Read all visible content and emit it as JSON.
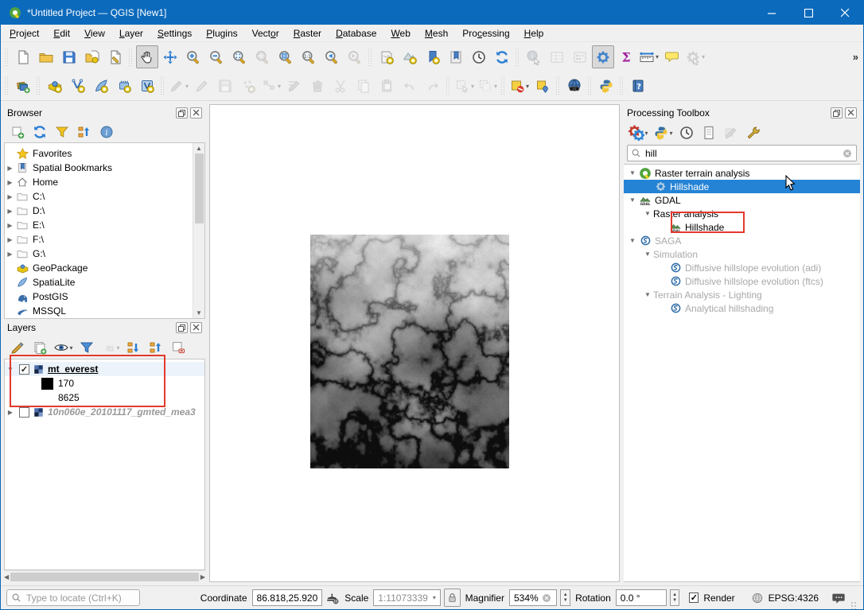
{
  "window": {
    "title": "*Untitled Project — QGIS [New1]"
  },
  "menu": {
    "items": [
      {
        "label": "Project",
        "u": 0
      },
      {
        "label": "Edit",
        "u": 0
      },
      {
        "label": "View",
        "u": 0
      },
      {
        "label": "Layer",
        "u": 0
      },
      {
        "label": "Settings",
        "u": 0
      },
      {
        "label": "Plugins",
        "u": 0
      },
      {
        "label": "Vector",
        "u": 4
      },
      {
        "label": "Raster",
        "u": 0
      },
      {
        "label": "Database",
        "u": 0
      },
      {
        "label": "Web",
        "u": 0
      },
      {
        "label": "Mesh",
        "u": 0
      },
      {
        "label": "Processing",
        "u": 3
      },
      {
        "label": "Help",
        "u": 0
      }
    ]
  },
  "toolbar_main": {
    "overflow": "»",
    "groups": [
      [
        {
          "icon": "new-project"
        },
        {
          "icon": "open-project"
        },
        {
          "icon": "save-project"
        },
        {
          "icon": "style-manager"
        },
        {
          "icon": "project-properties"
        }
      ],
      [
        {
          "icon": "pan-map",
          "active": true
        },
        {
          "icon": "pan-to-selection"
        },
        {
          "icon": "zoom-in"
        },
        {
          "icon": "zoom-out"
        },
        {
          "icon": "zoom-full"
        },
        {
          "icon": "zoom-to-selection",
          "disabled": true
        },
        {
          "icon": "zoom-to-layer"
        },
        {
          "icon": "zoom-native"
        },
        {
          "icon": "zoom-last"
        },
        {
          "icon": "zoom-next",
          "disabled": true
        }
      ],
      [
        {
          "icon": "new-map-view"
        },
        {
          "icon": "new-3d-map-view"
        },
        {
          "icon": "new-spatial-bookmark"
        },
        {
          "icon": "show-spatial-bookmarks"
        },
        {
          "icon": "temporal-controller"
        },
        {
          "icon": "refresh-map"
        }
      ],
      [
        {
          "icon": "identify-features",
          "disabled": true
        },
        {
          "icon": "open-attribute-table",
          "disabled": true
        },
        {
          "icon": "field-calculator",
          "disabled": true
        },
        {
          "icon": "processing-toolbox",
          "active": true
        },
        {
          "icon": "statistical-summary"
        },
        {
          "icon": "measure-line",
          "dd": true
        },
        {
          "icon": "map-tips"
        },
        {
          "icon": "run-feature-action",
          "disabled": true,
          "dd": true
        }
      ]
    ]
  },
  "toolbar_edit": {
    "groups": [
      [
        {
          "icon": "data-source-manager"
        }
      ],
      [
        {
          "icon": "new-geopackage-layer"
        },
        {
          "icon": "new-shapefile-layer"
        },
        {
          "icon": "new-spatialite-layer"
        },
        {
          "icon": "new-mesh-layer"
        },
        {
          "icon": "new-virtual-layer"
        }
      ],
      [
        {
          "icon": "current-edits",
          "disabled": true,
          "dd": true
        },
        {
          "icon": "toggle-editing",
          "disabled": true
        },
        {
          "icon": "save-layer-edits",
          "disabled": true
        },
        {
          "icon": "digitize",
          "disabled": true
        },
        {
          "icon": "vertex-tool",
          "disabled": true,
          "dd": true
        },
        {
          "icon": "modify-attributes",
          "disabled": true
        },
        {
          "icon": "delete-selected",
          "disabled": true
        },
        {
          "icon": "cut-features",
          "disabled": true
        },
        {
          "icon": "copy-features",
          "disabled": true
        },
        {
          "icon": "paste-features",
          "disabled": true
        },
        {
          "icon": "undo",
          "disabled": true
        },
        {
          "icon": "redo",
          "disabled": true
        }
      ],
      [
        {
          "icon": "select-features",
          "disabled": true,
          "dd": true
        },
        {
          "icon": "deselect-features",
          "disabled": true,
          "dd": true
        }
      ],
      [
        {
          "icon": "layer-labeling",
          "dd": true
        },
        {
          "icon": "label-pin"
        }
      ],
      [
        {
          "icon": "metasearch"
        }
      ],
      [
        {
          "icon": "python-console"
        }
      ],
      [
        {
          "icon": "help-contents"
        }
      ]
    ]
  },
  "browser": {
    "title": "Browser",
    "tools": [
      {
        "icon": "add-selected-layer"
      },
      {
        "icon": "refresh-browser"
      },
      {
        "icon": "filter-browser"
      },
      {
        "icon": "collapse-all"
      },
      {
        "icon": "browser-properties"
      }
    ],
    "items": [
      {
        "icon": "star",
        "label": "Favorites"
      },
      {
        "icon": "bookmark",
        "label": "Spatial Bookmarks",
        "arrow": true
      },
      {
        "icon": "home",
        "label": "Home",
        "arrow": true
      },
      {
        "icon": "drive",
        "label": "C:\\",
        "arrow": true
      },
      {
        "icon": "drive",
        "label": "D:\\",
        "arrow": true
      },
      {
        "icon": "drive",
        "label": "E:\\",
        "arrow": true
      },
      {
        "icon": "drive",
        "label": "F:\\",
        "arrow": true
      },
      {
        "icon": "drive",
        "label": "G:\\",
        "arrow": true
      },
      {
        "icon": "geopackage",
        "label": "GeoPackage"
      },
      {
        "icon": "spatialite",
        "label": "SpatiaLite"
      },
      {
        "icon": "postgis",
        "label": "PostGIS"
      },
      {
        "icon": "mssql",
        "label": "MSSQL"
      }
    ]
  },
  "layers_panel": {
    "title": "Layers",
    "tools": [
      {
        "icon": "layer-styling"
      },
      {
        "icon": "add-group"
      },
      {
        "icon": "manage-themes",
        "dd": true
      },
      {
        "icon": "filter-legend"
      },
      {
        "icon": "filter-expression",
        "disabled": true,
        "dd": true
      },
      {
        "icon": "expand-all"
      },
      {
        "icon": "collapse-all2"
      },
      {
        "icon": "remove-layer"
      }
    ],
    "layers": [
      {
        "name": "mt_everest",
        "checked": true,
        "selected": true,
        "legend": [
          {
            "swatch": "#000000",
            "label": "170"
          },
          {
            "swatch": "#ffffff",
            "label": "8625"
          }
        ]
      },
      {
        "name": "10n060e_20101117_gmted_mea3",
        "checked": false,
        "italic": true
      }
    ]
  },
  "processing": {
    "title": "Processing Toolbox",
    "tools": [
      {
        "icon": "models",
        "dd": true
      },
      {
        "icon": "python-console",
        "dd": true
      },
      {
        "icon": "history"
      },
      {
        "icon": "results-viewer"
      },
      {
        "icon": "edit-in-place",
        "disabled": true
      },
      {
        "icon": "options-wrench"
      }
    ],
    "search_value": "hill",
    "tree": [
      {
        "depth": 0,
        "arrow": true,
        "icon": "qgis-logo",
        "label": "Raster terrain analysis"
      },
      {
        "depth": 1,
        "icon": "gear-light",
        "label": "Hillshade",
        "selected": true
      },
      {
        "depth": 0,
        "arrow": true,
        "icon": "gdal",
        "label": "GDAL"
      },
      {
        "depth": 1,
        "arrow": true,
        "label": "Raster analysis"
      },
      {
        "depth": 2,
        "icon": "gdal",
        "label": "Hillshade"
      },
      {
        "depth": 0,
        "arrow": true,
        "icon": "saga",
        "label": "SAGA",
        "disabled": true
      },
      {
        "depth": 1,
        "arrow": true,
        "label": "Simulation",
        "disabled": true
      },
      {
        "depth": 2,
        "icon": "saga",
        "label": "Diffusive hillslope evolution (adi)",
        "disabled": true
      },
      {
        "depth": 2,
        "icon": "saga",
        "label": "Diffusive hillslope evolution (ftcs)",
        "disabled": true
      },
      {
        "depth": 1,
        "arrow": true,
        "label": "Terrain Analysis - Lighting",
        "disabled": true
      },
      {
        "depth": 2,
        "icon": "saga",
        "label": "Analytical hillshading",
        "disabled": true
      }
    ]
  },
  "statusbar": {
    "locate_placeholder": "Type to locate (Ctrl+K)",
    "coordinate_label": "Coordinate",
    "coordinate_value": "86.818,25.920",
    "scale_label": "Scale",
    "scale_value": "1:11073339",
    "magnifier_label": "Magnifier",
    "magnifier_value": "534%",
    "rotation_label": "Rotation",
    "rotation_value": "0.0 °",
    "render_label": "Render",
    "crs_label": "EPSG:4326"
  }
}
